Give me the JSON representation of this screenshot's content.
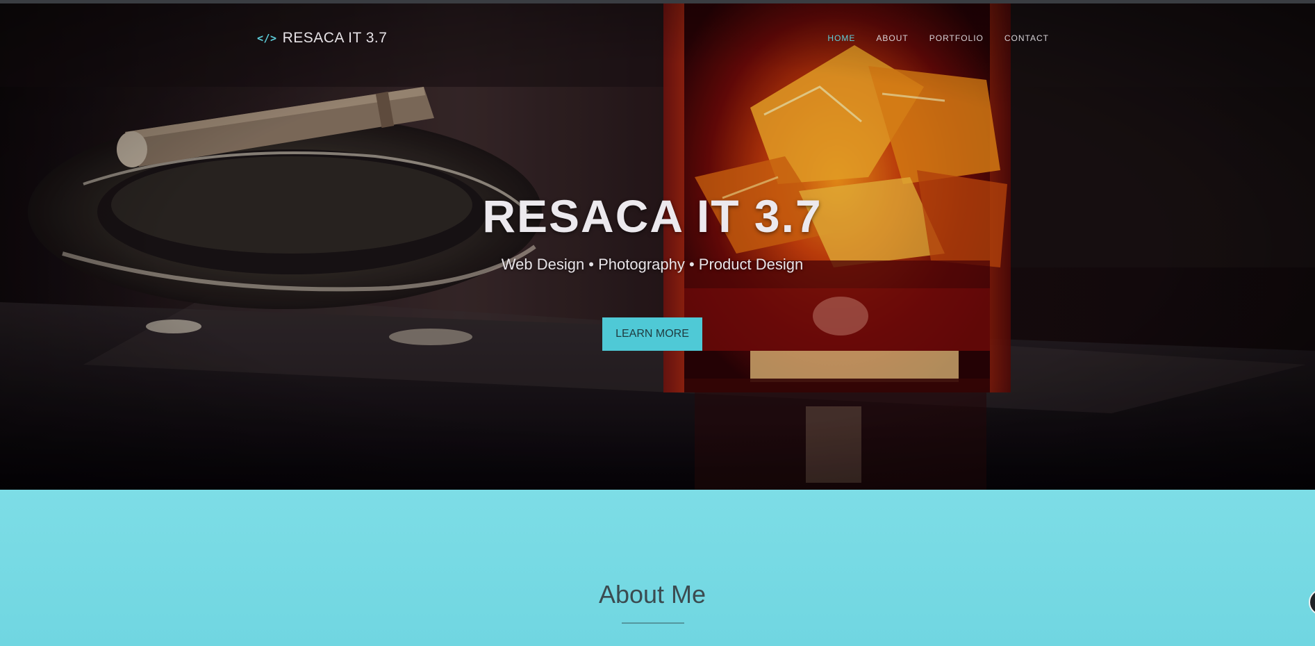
{
  "nav": {
    "brand_icon": "</>",
    "brand": "RESACA IT 3.7",
    "links": [
      {
        "label": "HOME",
        "active": true
      },
      {
        "label": "ABOUT",
        "active": false
      },
      {
        "label": "PORTFOLIO",
        "active": false
      },
      {
        "label": "CONTACT",
        "active": false
      }
    ]
  },
  "hero": {
    "title": "RESACA IT 3.7",
    "subtitle": "Web Design • Photography • Product Design",
    "cta_label": "LEARN MORE"
  },
  "about": {
    "title": "About Me"
  },
  "colors": {
    "accent": "#4fc9d6",
    "about_bg": "#74d8e2",
    "hero_dark": "#0d0609"
  },
  "icons": {
    "brand": "code-icon",
    "scroll": "scroll-top-icon"
  }
}
